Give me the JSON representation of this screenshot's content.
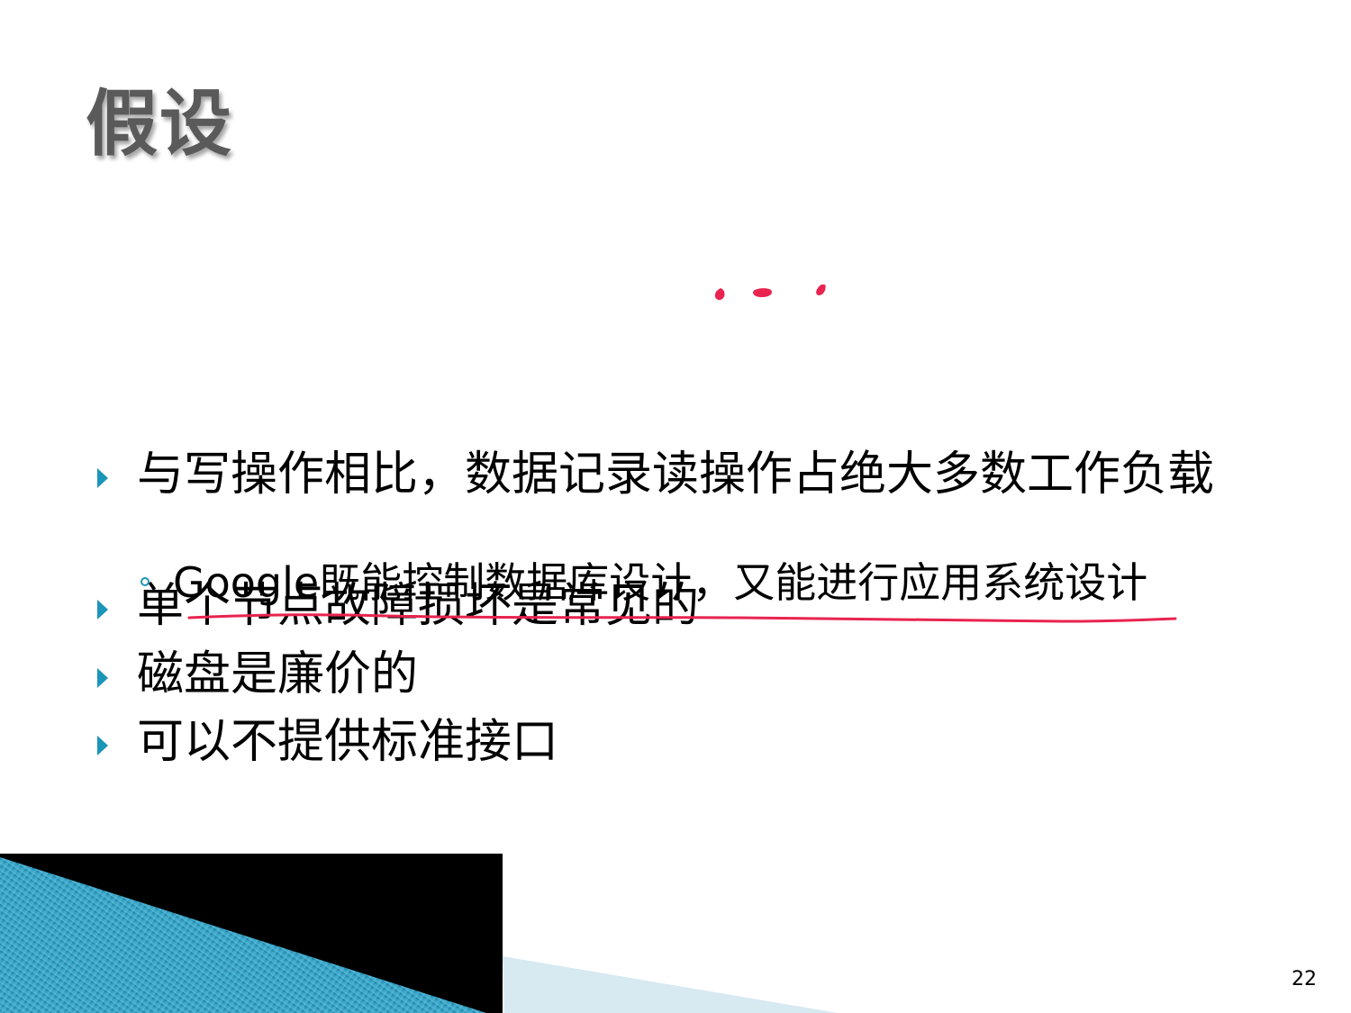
{
  "slide": {
    "title": "假设",
    "page_number": "22",
    "bullets": [
      {
        "text": "与写操作相比，数据记录读操作占绝大多数工作负载"
      },
      {
        "text": "单个节点故障损坏是常见的"
      },
      {
        "text": "磁盘是廉价的"
      },
      {
        "text": "可以不提供标准接口"
      }
    ],
    "sub_bullets": [
      {
        "text": "Google既能控制数据库设计，又能进行应用系统设计"
      }
    ]
  },
  "colors": {
    "title": "#5a5a5a",
    "bullet_marker": "#1b95b8",
    "annotation_ink": "#e8244f",
    "corner_dark": "#000000",
    "corner_blue": "#1b8fb4",
    "corner_light": "#d7e9f1"
  }
}
